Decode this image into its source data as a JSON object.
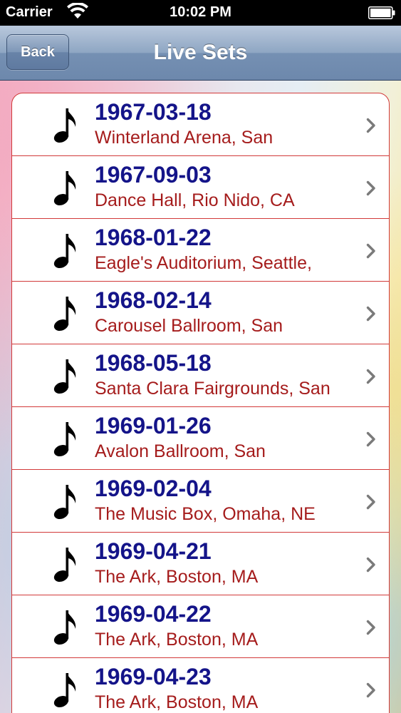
{
  "status_bar": {
    "carrier": "Carrier",
    "time": "10:02 PM"
  },
  "nav": {
    "back_label": "Back",
    "title": "Live Sets"
  },
  "colors": {
    "date_text": "#141489",
    "venue_text": "#a51c1c",
    "row_border": "#d23a3a"
  },
  "sets": [
    {
      "date": "1967-03-18",
      "venue": "Winterland Arena, San",
      "icon": "music-note-icon"
    },
    {
      "date": "1967-09-03",
      "venue": "Dance Hall, Rio Nido, CA",
      "icon": "music-note-icon"
    },
    {
      "date": "1968-01-22",
      "venue": "Eagle's Auditorium, Seattle,",
      "icon": "music-note-icon"
    },
    {
      "date": "1968-02-14",
      "venue": "Carousel Ballroom, San",
      "icon": "music-note-icon"
    },
    {
      "date": "1968-05-18",
      "venue": "Santa Clara Fairgrounds, San",
      "icon": "music-note-icon"
    },
    {
      "date": "1969-01-26",
      "venue": "Avalon Ballroom, San",
      "icon": "music-note-icon"
    },
    {
      "date": "1969-02-04",
      "venue": "The Music Box, Omaha, NE",
      "icon": "music-note-icon"
    },
    {
      "date": "1969-04-21",
      "venue": "The Ark, Boston, MA",
      "icon": "music-note-icon"
    },
    {
      "date": "1969-04-22",
      "venue": "The Ark, Boston, MA",
      "icon": "music-note-icon"
    },
    {
      "date": "1969-04-23",
      "venue": "The Ark, Boston, MA",
      "icon": "music-note-icon"
    }
  ]
}
